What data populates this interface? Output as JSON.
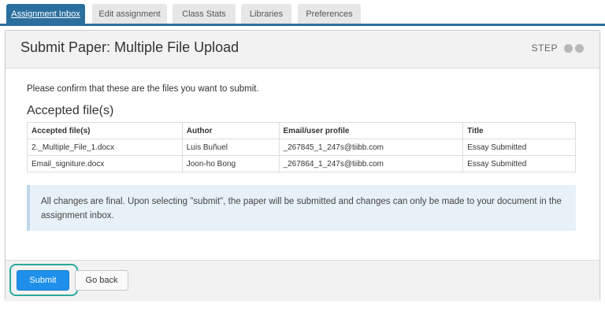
{
  "tabs": [
    {
      "label": "Assignment Inbox",
      "active": true
    },
    {
      "label": "Edit assignment",
      "active": false
    },
    {
      "label": "Class Stats",
      "active": false
    },
    {
      "label": "Libraries",
      "active": false
    },
    {
      "label": "Preferences",
      "active": false
    }
  ],
  "page": {
    "title": "Submit Paper: Multiple File Upload",
    "step_label": "STEP"
  },
  "body": {
    "confirm_text": "Please confirm that these are the files you want to submit.",
    "section_title": "Accepted file(s)"
  },
  "table": {
    "headers": [
      "Accepted file(s)",
      "Author",
      "Email/user profile",
      "Title"
    ],
    "rows": [
      [
        "2._Multiple_File_1.docx",
        "Luis Buñuel",
        "_267845_1_247s@tiibb.com",
        "Essay Submitted"
      ],
      [
        "Email_signiture.docx",
        "Joon-ho Bong",
        "_267864_1_247s@tiibb.com",
        "Essay Submitted"
      ]
    ]
  },
  "notice": "All changes are final. Upon selecting \"submit\", the paper will be submitted and changes can only be made to your document in the assignment inbox.",
  "footer": {
    "submit_label": "Submit",
    "back_label": "Go back"
  },
  "colors": {
    "accent": "#2b6f9e",
    "submit_button": "#1e8fea",
    "highlight_ring": "#2ba99c",
    "notice_bg": "#e9f1f8"
  }
}
